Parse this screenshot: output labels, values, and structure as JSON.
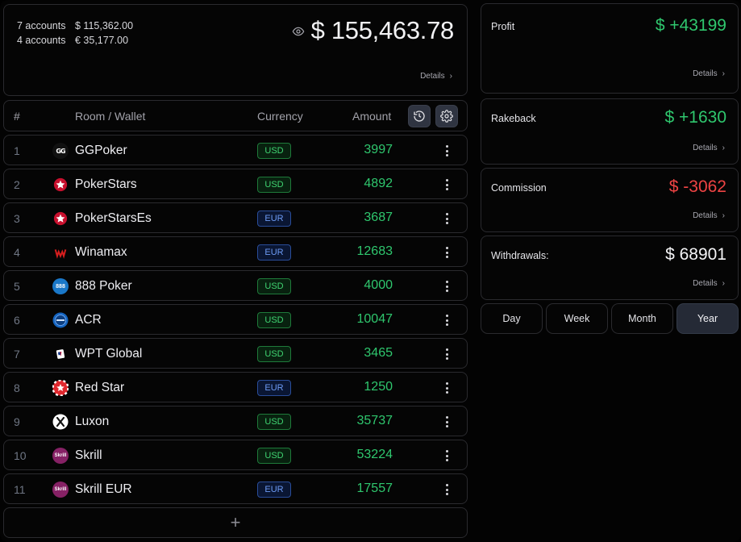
{
  "summary": {
    "accounts": [
      {
        "count": "7 accounts",
        "total": "$ 115,362.00"
      },
      {
        "count": "4 accounts",
        "total": "€ 35,177.00"
      }
    ],
    "grand_total": "$ 155,463.78",
    "details_label": "Details"
  },
  "table": {
    "headers": {
      "num": "#",
      "room": "Room / Wallet",
      "currency": "Currency",
      "amount": "Amount"
    },
    "rows": [
      {
        "num": "1",
        "name": "GGPoker",
        "currency": "USD",
        "amount": "3997",
        "logo": "ggpoker-logo"
      },
      {
        "num": "2",
        "name": "PokerStars",
        "currency": "USD",
        "amount": "4892",
        "logo": "pokerstars-logo"
      },
      {
        "num": "3",
        "name": "PokerStarsEs",
        "currency": "EUR",
        "amount": "3687",
        "logo": "pokerstars-logo"
      },
      {
        "num": "4",
        "name": "Winamax",
        "currency": "EUR",
        "amount": "12683",
        "logo": "winamax-logo"
      },
      {
        "num": "5",
        "name": "888 Poker",
        "currency": "USD",
        "amount": "4000",
        "logo": "888poker-logo"
      },
      {
        "num": "6",
        "name": "ACR",
        "currency": "USD",
        "amount": "10047",
        "logo": "acr-logo"
      },
      {
        "num": "7",
        "name": "WPT Global",
        "currency": "USD",
        "amount": "3465",
        "logo": "wpt-logo"
      },
      {
        "num": "8",
        "name": "Red Star",
        "currency": "EUR",
        "amount": "1250",
        "logo": "redstar-logo"
      },
      {
        "num": "9",
        "name": "Luxon",
        "currency": "USD",
        "amount": "35737",
        "logo": "luxon-logo"
      },
      {
        "num": "10",
        "name": "Skrill",
        "currency": "USD",
        "amount": "53224",
        "logo": "skrill-logo"
      },
      {
        "num": "11",
        "name": "Skrill EUR",
        "currency": "EUR",
        "amount": "17557",
        "logo": "skrill-logo"
      }
    ],
    "add_label": "+"
  },
  "stats": [
    {
      "label": "Profit",
      "value": "$ +43199",
      "tone": "pos",
      "details": "Details"
    },
    {
      "label": "Rakeback",
      "value": "$ +1630",
      "tone": "pos",
      "details": "Details"
    },
    {
      "label": "Commission",
      "value": "$ -3062",
      "tone": "neg",
      "details": "Details"
    },
    {
      "label": "Withdrawals:",
      "value": "$ 68901",
      "tone": "wht",
      "details": "Details"
    }
  ],
  "periods": [
    {
      "label": "Day",
      "active": false
    },
    {
      "label": "Week",
      "active": false
    },
    {
      "label": "Month",
      "active": false
    },
    {
      "label": "Year",
      "active": true
    }
  ],
  "colors": {
    "positive": "#2fc76e",
    "negative": "#ef4444",
    "usd_badge": "#40d572",
    "eur_badge": "#6d9bf5",
    "active_period": "#252a36"
  }
}
